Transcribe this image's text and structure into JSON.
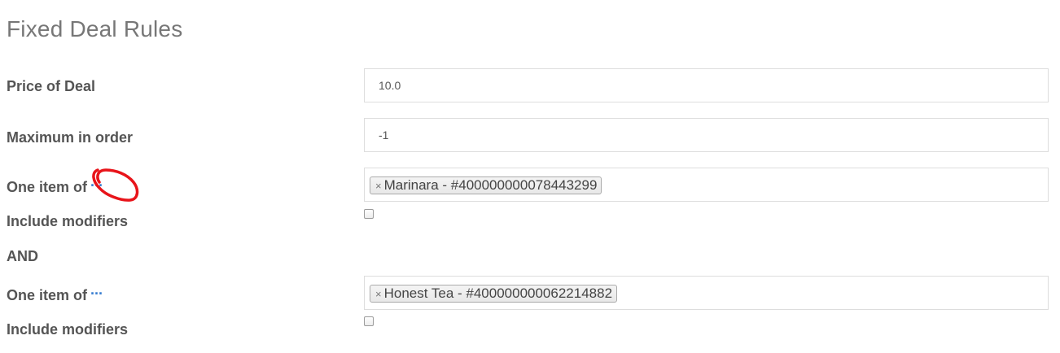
{
  "page": {
    "title": "Fixed Deal Rules"
  },
  "rules": {
    "price_label": "Price of Deal",
    "price_value": "10.0",
    "max_label": "Maximum in order",
    "max_value": "-1",
    "group1": {
      "label": "One item of",
      "more_icon": "···",
      "tag_remove": "×",
      "tag_text": "Marinara - #400000000078443299",
      "include_label": "Include modifiers",
      "include_checked": false
    },
    "and_label": "AND",
    "group2": {
      "label": "One item of",
      "more_icon": "···",
      "tag_remove": "×",
      "tag_text": "Honest Tea - #400000000062214882",
      "include_label": "Include modifiers",
      "include_checked": false
    }
  },
  "colors": {
    "link": "#3a7fd1",
    "annotation": "#e8141a"
  }
}
